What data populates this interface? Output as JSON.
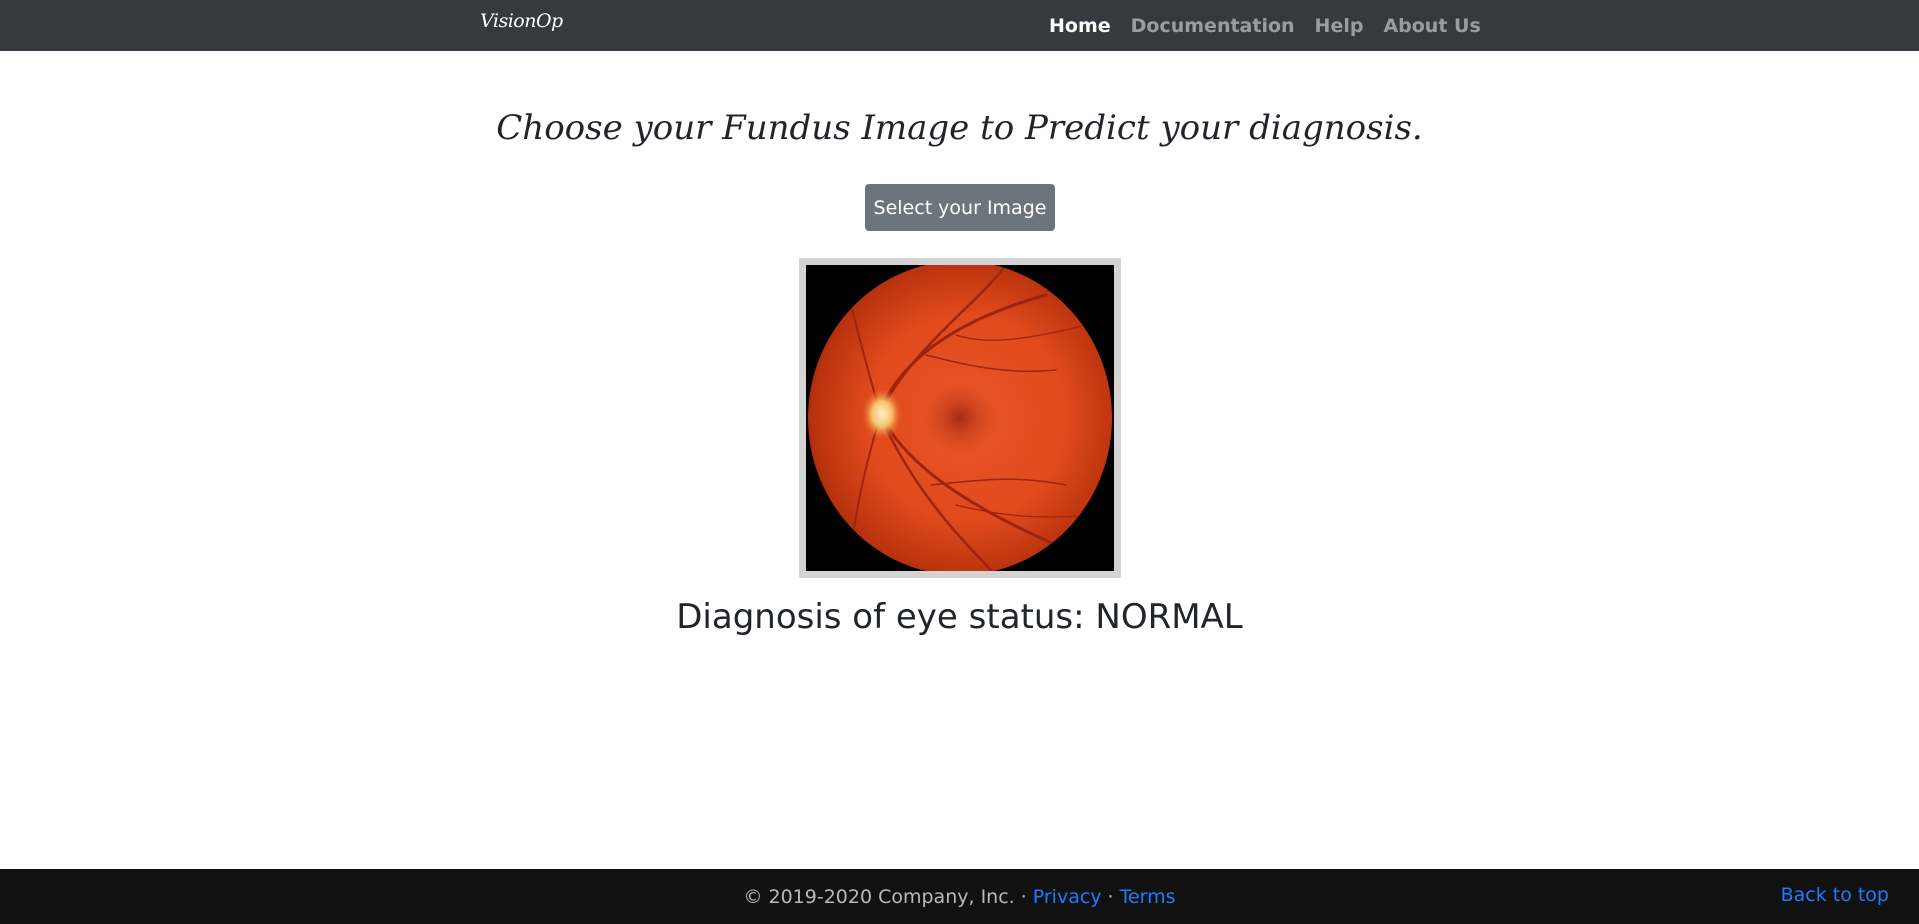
{
  "navbar": {
    "brand": "VisionOp",
    "links": [
      {
        "label": "Home",
        "active": true
      },
      {
        "label": "Documentation",
        "active": false
      },
      {
        "label": "Help",
        "active": false
      },
      {
        "label": "About Us",
        "active": false
      }
    ]
  },
  "main": {
    "headline": "Choose your Fundus Image to Predict your diagnosis.",
    "select_button_label": "Select your Image",
    "diagnosis_text": "Diagnosis of eye status: NORMAL"
  },
  "footer": {
    "copyright": "© 2019-2020 Company, Inc.",
    "separator": "·",
    "privacy_label": "Privacy",
    "terms_label": "Terms",
    "back_to_top_label": "Back to top"
  },
  "colors": {
    "navbar_bg": "#343a40",
    "footer_bg": "#111111",
    "button_bg": "#6c757d",
    "link": "#1f7bff"
  }
}
